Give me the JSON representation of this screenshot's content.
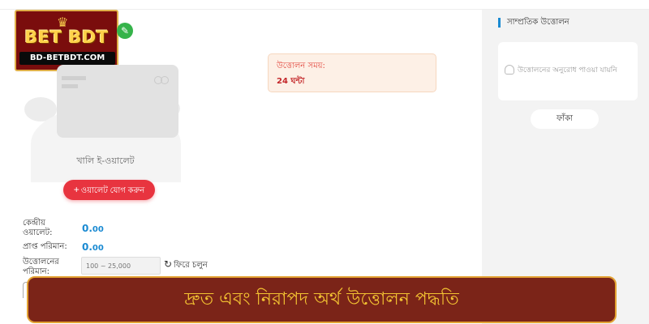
{
  "logo": {
    "brand": "BET BDT",
    "url": "BD-BETBDT.COM",
    "icon": "crown-icon"
  },
  "wallet": {
    "empty_label": "খালি ই-ওয়ালেট",
    "add_button": "ওয়ালেট যোগ করুন",
    "edit_icon": "pencil-icon"
  },
  "info": {
    "label": "উত্তোলন সময়:",
    "value": "24 ঘন্টা"
  },
  "rows": {
    "central_wallet_label_1": "কেন্দ্রীয়",
    "central_wallet_label_2": "ওয়ালেট:",
    "central_wallet_value": "0.",
    "central_wallet_decimals": "00",
    "received_label": "প্রাপ্ত পরিমান:",
    "received_value": "0.",
    "received_decimals": "00",
    "withdraw_label_1": "উত্তোলনের",
    "withdraw_label_2": "পরিমান:",
    "amount_placeholder": "100 ~ 25,000",
    "back_label": "ফিরে চলুন"
  },
  "recent": {
    "title": "সাম্প্রতিক উত্তোলন",
    "empty_message": "উত্তোলনের অনুরোধ পাওয়া যায়নি",
    "empty_pill": "ফাঁকা"
  },
  "banner": {
    "text": "দ্রুত এবং নিরাপদ অর্থ উত্তোলন পদ্ধতি"
  },
  "colors": {
    "accent": "#e8343f",
    "blue": "#1a8ad2",
    "banner_bg": "#7b2418",
    "banner_text": "#f3c332"
  }
}
